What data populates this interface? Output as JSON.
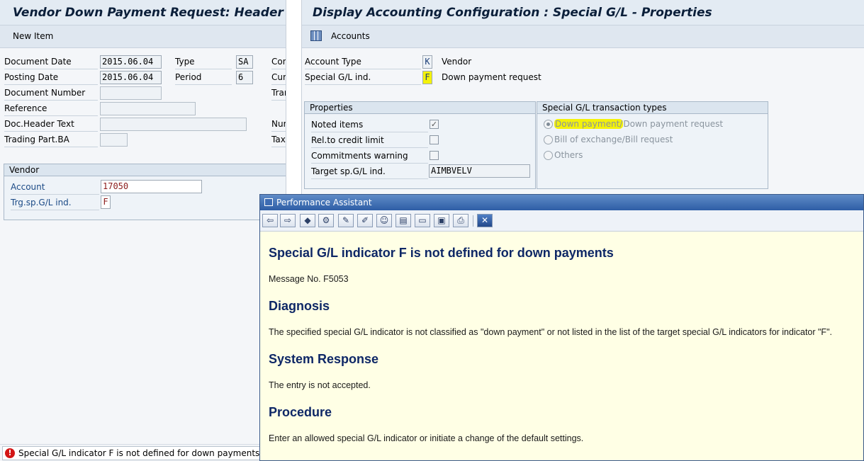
{
  "left": {
    "title": "Vendor Down Payment Request: Header Data",
    "toolbar": {
      "new_item": "New Item"
    },
    "fields": {
      "document_date": {
        "label": "Document Date",
        "value": "2015.06.04"
      },
      "type": {
        "label": "Type",
        "value": "SA"
      },
      "con": {
        "label": "Con"
      },
      "posting_date": {
        "label": "Posting Date",
        "value": "2015.06.04"
      },
      "period": {
        "label": "Period",
        "value": "6"
      },
      "curr": {
        "label": "Curr"
      },
      "document_number": {
        "label": "Document Number",
        "value": ""
      },
      "tran": {
        "label": "Tran"
      },
      "reference": {
        "label": "Reference",
        "value": ""
      },
      "doc_header_text": {
        "label": "Doc.Header Text",
        "value": ""
      },
      "num": {
        "label": "Num"
      },
      "trading_part_ba": {
        "label": "Trading Part.BA",
        "value": ""
      },
      "tax": {
        "label": "Tax"
      }
    },
    "vendor_group": {
      "title": "Vendor",
      "account": {
        "label": "Account",
        "value": "17050"
      },
      "trg_sp_gl_ind": {
        "label": "Trg.sp.G/L ind.",
        "value": "F"
      }
    },
    "status": {
      "message": "Special G/L indicator F is not defined for down payments",
      "icon": "error-icon"
    }
  },
  "right": {
    "title": "Display Accounting Configuration : Special G/L - Properties",
    "toolbar": {
      "accounts": "Accounts",
      "icon": "table-icon"
    },
    "account_type": {
      "label": "Account Type",
      "value": "K",
      "text": "Vendor"
    },
    "special_gl_ind": {
      "label": "Special G/L ind.",
      "value": "F",
      "text": "Down payment request"
    },
    "properties": {
      "title": "Properties",
      "noted_items": {
        "label": "Noted items",
        "checked": true
      },
      "rel_credit_limit": {
        "label": "Rel.to credit limit",
        "checked": false
      },
      "commitments_warning": {
        "label": "Commitments warning",
        "checked": false
      },
      "target_sp_gl_ind": {
        "label": "Target sp.G/L ind.",
        "value": "AIMBVELV"
      }
    },
    "transaction_types": {
      "title": "Special G/L transaction types",
      "options": [
        {
          "label_a": "Down payment/",
          "label_b": "Down payment request",
          "selected": true
        },
        {
          "label_a": "Bill of exchange/Bill request",
          "label_b": "",
          "selected": false
        },
        {
          "label_a": "Others",
          "label_b": "",
          "selected": false
        }
      ]
    }
  },
  "assistant": {
    "title": "Performance Assistant",
    "toolbar_icons": [
      "back-icon",
      "forward-icon",
      "hint-icon",
      "technical-info-icon",
      "edit-icon",
      "highlight-icon",
      "users-icon",
      "list-icon",
      "print-preview-icon",
      "save-icon",
      "print-icon",
      "close-icon"
    ],
    "heading": "Special G/L indicator F is not defined for down payments",
    "message_no": "Message No. F5053",
    "sections": [
      {
        "title": "Diagnosis",
        "text": "The specified special G/L indicator is not classified as \"down payment\" or not listed in the list of the target special G/L indicators for indicator \"F\"."
      },
      {
        "title": "System Response",
        "text": "The entry is not accepted."
      },
      {
        "title": "Procedure",
        "text": "Enter an allowed special G/L indicator or initiate a change of the default settings."
      }
    ]
  }
}
